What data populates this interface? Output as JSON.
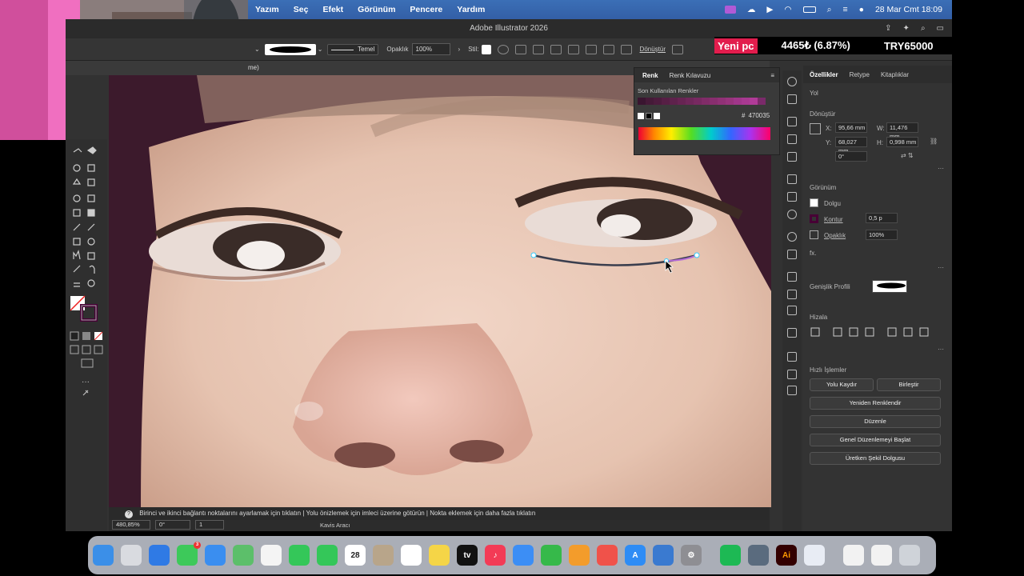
{
  "menubar": {
    "items": [
      "Yazım",
      "Seç",
      "Efekt",
      "Görünüm",
      "Pencere",
      "Yardım"
    ],
    "datetime": "28 Mar Cmt  18:09"
  },
  "ticker": {
    "tag": "Yeni pc",
    "value": "4465₺ (6.87%)",
    "target": "TRY65000"
  },
  "window": {
    "title": "Adobe Illustrator 2026"
  },
  "controlbar": {
    "stroke_style": "Temel",
    "opacity_label": "Opaklık",
    "opacity_value": "100%",
    "style_label": "Stil:",
    "transform_label": "Dönüştür"
  },
  "doctab": {
    "label": "me)"
  },
  "color_panel": {
    "tabs": [
      "Renk",
      "Renk Kılavuzu"
    ],
    "recent_label": "Son Kullanılan Renkler",
    "hex_label": "#",
    "hex_value": "470035",
    "recent_colors": [
      "#3a1530",
      "#451a38",
      "#4d1c3e",
      "#561f45",
      "#5e224c",
      "#672453",
      "#6f275a",
      "#772961",
      "#802c68",
      "#882e6f",
      "#903176",
      "#98347d",
      "#a0368a",
      "#a83991",
      "#b03b98",
      "#7a2a6a"
    ]
  },
  "properties": {
    "tabs": [
      "Özellikler",
      "Retype",
      "Kitaplıklar"
    ],
    "path_label": "Yol",
    "transform_label": "Dönüştür",
    "x_label": "X:",
    "x_value": "95,66 mm",
    "w_label": "W:",
    "w_value": "11,476 mm",
    "y_label": "Y:",
    "y_value": "68,027 mm",
    "h_label": "H:",
    "h_value": "0,998 mm",
    "angle_value": "0°",
    "appearance_label": "Görünüm",
    "fill_label": "Dolgu",
    "stroke_label": "Kontur",
    "stroke_value": "0,5 p",
    "opacity_label": "Opaklık",
    "opacity_value": "100%",
    "fx_label": "fx.",
    "width_profile_label": "Genişlik Profili",
    "align_label": "Hizala",
    "quick_actions_label": "Hızlı İşlemler",
    "btn_offset_path": "Yolu Kaydır",
    "btn_unite": "Birleştir",
    "btn_recolor": "Yeniden Renklendir",
    "btn_arrange": "Düzenle",
    "btn_global_edit": "Genel Düzenlemeyi Başlat",
    "btn_generative_fill": "Üretken Şekil Dolgusu"
  },
  "statusbar": {
    "hint": "Birinci ve ikinci bağlantı noktalarını ayarlamak için tıklatın  |  Yolu önizlemek için imleci üzerine götürün  |  Nokta eklemek için daha fazla tıklatın",
    "zoom": "480,85%",
    "angle": "0°",
    "artboard": "1",
    "tool": "Kavis Aracı"
  },
  "dock": {
    "calendar_day": "28",
    "messages_badge": "3",
    "apps": [
      {
        "name": "finder",
        "color": "#3b8fe8",
        "label": ""
      },
      {
        "name": "launchpad",
        "color": "#d9dbe0",
        "label": ""
      },
      {
        "name": "safari",
        "color": "#2f7ae5",
        "label": ""
      },
      {
        "name": "messages",
        "color": "#3dc95a",
        "label": ""
      },
      {
        "name": "mail",
        "color": "#3a8ef0",
        "label": ""
      },
      {
        "name": "maps",
        "color": "#5cbf6a",
        "label": ""
      },
      {
        "name": "photos",
        "color": "#f4f4f4",
        "label": ""
      },
      {
        "name": "facetime",
        "color": "#34c759",
        "label": ""
      },
      {
        "name": "phone",
        "color": "#34c759",
        "label": ""
      },
      {
        "name": "calendar",
        "color": "#ffffff",
        "label": ""
      },
      {
        "name": "contacts",
        "color": "#b8a58a",
        "label": ""
      },
      {
        "name": "reminders",
        "color": "#ffffff",
        "label": ""
      },
      {
        "name": "notes",
        "color": "#f5d547",
        "label": ""
      },
      {
        "name": "apple-tv",
        "color": "#111111",
        "label": "tv"
      },
      {
        "name": "music",
        "color": "#f33b56",
        "label": "♪"
      },
      {
        "name": "keynote",
        "color": "#3c8ef5",
        "label": ""
      },
      {
        "name": "numbers",
        "color": "#36b94a",
        "label": ""
      },
      {
        "name": "pages",
        "color": "#f39c2b",
        "label": ""
      },
      {
        "name": "launch",
        "color": "#f0524a",
        "label": ""
      },
      {
        "name": "app-store",
        "color": "#2e8cf5",
        "label": "A"
      },
      {
        "name": "preview",
        "color": "#3a7ad0",
        "label": ""
      },
      {
        "name": "settings",
        "color": "#8e8e93",
        "label": "⚙"
      },
      {
        "name": "spotify",
        "color": "#1db954",
        "label": ""
      },
      {
        "name": "finder-2",
        "color": "#5a6b7e",
        "label": ""
      },
      {
        "name": "illustrator",
        "color": "#330000",
        "label": "Ai"
      },
      {
        "name": "utility",
        "color": "#e8ecf4",
        "label": ""
      },
      {
        "name": "document",
        "color": "#f2f2f2",
        "label": ""
      },
      {
        "name": "screen",
        "color": "#f2f2f2",
        "label": ""
      },
      {
        "name": "trash",
        "color": "#cfd3d9",
        "label": ""
      }
    ]
  }
}
